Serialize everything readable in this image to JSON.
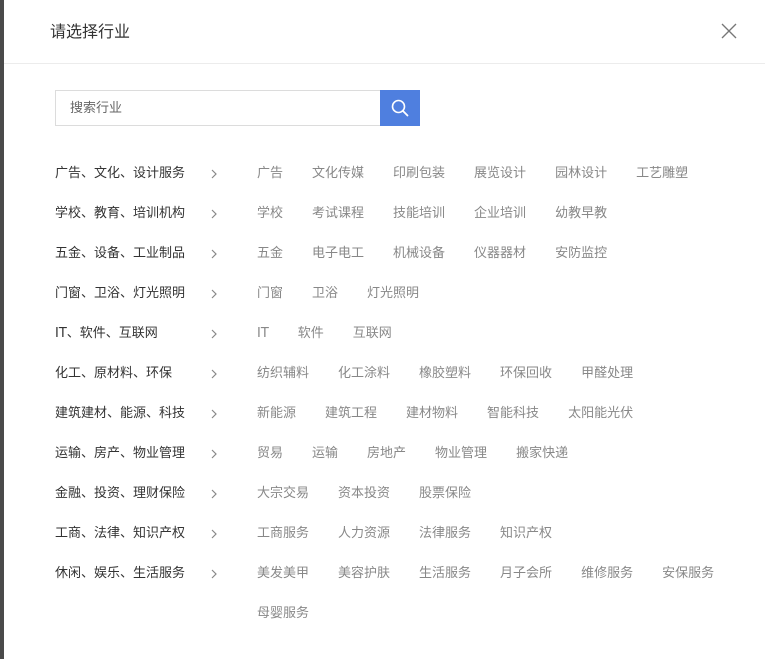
{
  "dialog": {
    "title": "请选择行业",
    "close_icon": "close-icon"
  },
  "search": {
    "placeholder": "搜索行业",
    "value": "",
    "button_icon": "search-icon",
    "button_color": "#4f7fdf"
  },
  "categories": [
    {
      "label": "广告、文化、设计服务",
      "items": [
        "广告",
        "文化传媒",
        "印刷包装",
        "展览设计",
        "园林设计",
        "工艺雕塑"
      ]
    },
    {
      "label": "学校、教育、培训机构",
      "items": [
        "学校",
        "考试课程",
        "技能培训",
        "企业培训",
        "幼教早教"
      ]
    },
    {
      "label": "五金、设备、工业制品",
      "items": [
        "五金",
        "电子电工",
        "机械设备",
        "仪器器材",
        "安防监控"
      ]
    },
    {
      "label": "门窗、卫浴、灯光照明",
      "items": [
        "门窗",
        "卫浴",
        "灯光照明"
      ]
    },
    {
      "label": "IT、软件、互联网",
      "items": [
        "IT",
        "软件",
        "互联网"
      ]
    },
    {
      "label": "化工、原材料、环保",
      "items": [
        "纺织辅料",
        "化工涂料",
        "橡胶塑料",
        "环保回收",
        "甲醛处理"
      ]
    },
    {
      "label": "建筑建材、能源、科技",
      "items": [
        "新能源",
        "建筑工程",
        "建材物料",
        "智能科技",
        "太阳能光伏"
      ]
    },
    {
      "label": "运输、房产、物业管理",
      "items": [
        "贸易",
        "运输",
        "房地产",
        "物业管理",
        "搬家快递"
      ]
    },
    {
      "label": "金融、投资、理财保险",
      "items": [
        "大宗交易",
        "资本投资",
        "股票保险"
      ]
    },
    {
      "label": "工商、法律、知识产权",
      "items": [
        "工商服务",
        "人力资源",
        "法律服务",
        "知识产权"
      ]
    },
    {
      "label": "休闲、娱乐、生活服务",
      "items": [
        "美发美甲",
        "美容护肤",
        "生活服务",
        "月子会所",
        "维修服务",
        "安保服务",
        "母婴服务"
      ]
    }
  ]
}
